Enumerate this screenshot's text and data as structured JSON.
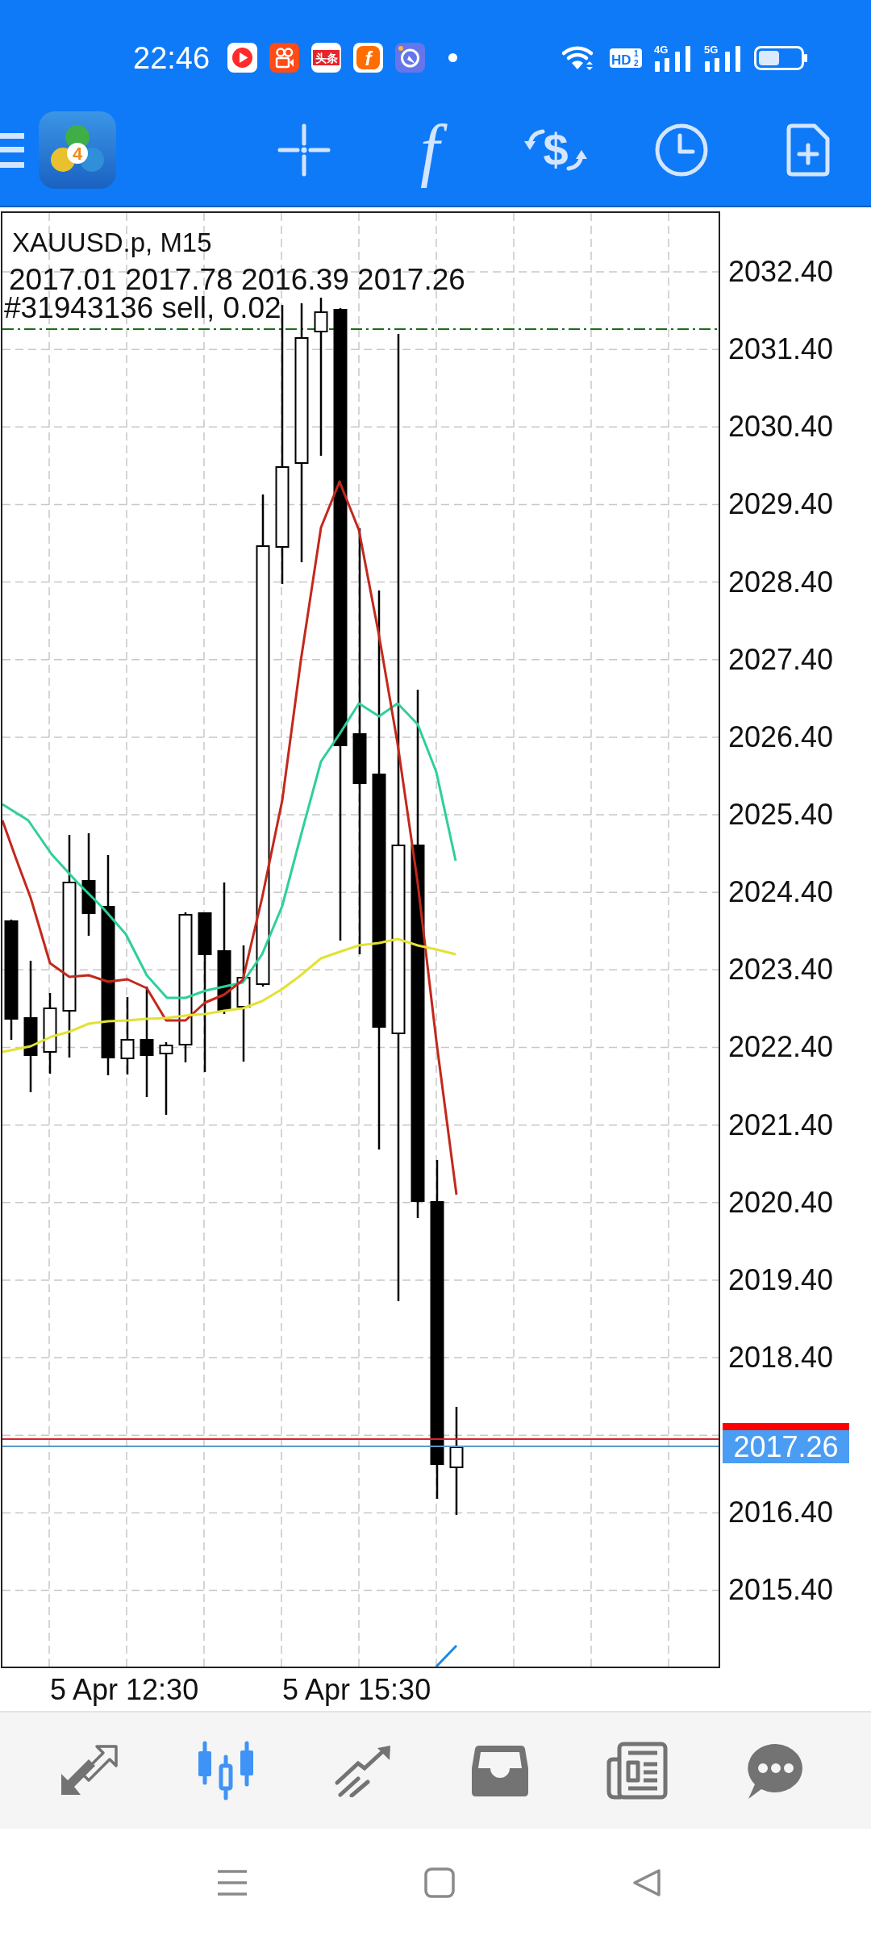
{
  "status_bar": {
    "time": "22:46",
    "notification_icons": [
      {
        "kind": "play",
        "color": "#ff2b2b"
      },
      {
        "kind": "camera",
        "color": "#ff4b16"
      },
      {
        "kind": "text",
        "label": "头条",
        "color": "#e8232b"
      },
      {
        "kind": "letter",
        "label": "f",
        "color": "#ff6d00"
      },
      {
        "kind": "compass",
        "color": "#6476ea"
      }
    ],
    "indicators": [
      {
        "kind": "wifi"
      },
      {
        "kind": "hd",
        "label": "HD",
        "slots": [
          "1",
          "2"
        ]
      },
      {
        "kind": "signal",
        "label": "4G"
      },
      {
        "kind": "signal",
        "label": "5G"
      },
      {
        "kind": "battery"
      }
    ]
  },
  "toolbar": {
    "items": [
      {
        "kind": "menu"
      },
      {
        "kind": "logo",
        "label": "4"
      },
      {
        "kind": "crosshair"
      },
      {
        "kind": "glyph",
        "label": "f"
      },
      {
        "kind": "exchange",
        "label": "$"
      },
      {
        "kind": "clock"
      },
      {
        "kind": "document"
      }
    ]
  },
  "chart": {
    "symbol_line": "XAUUSD.p, M15",
    "ohlc_line": "2017.01 2017.78 2016.39 2017.26",
    "order_line": "#31943136 sell, 0.02",
    "price_axis_above": [
      "2032.40",
      "2031.40",
      "2030.40",
      "2029.40",
      "2028.40",
      "2027.40",
      "2026.40",
      "2025.40",
      "2024.40",
      "2023.40",
      "2022.40",
      "2021.40",
      "2020.40",
      "2019.40",
      "2018.40"
    ],
    "current_price": "2017.26",
    "price_axis_below": [
      "2016.40",
      "2015.40"
    ],
    "time_axis": [
      "5 Apr 12:30",
      "5 Apr 15:30"
    ]
  },
  "bottom_nav": [
    {
      "kind": "quotes",
      "selected": false
    },
    {
      "kind": "chart",
      "selected": true
    },
    {
      "kind": "trade",
      "selected": false
    },
    {
      "kind": "history",
      "selected": false
    },
    {
      "kind": "news",
      "selected": false
    },
    {
      "kind": "messages",
      "selected": false
    }
  ]
}
